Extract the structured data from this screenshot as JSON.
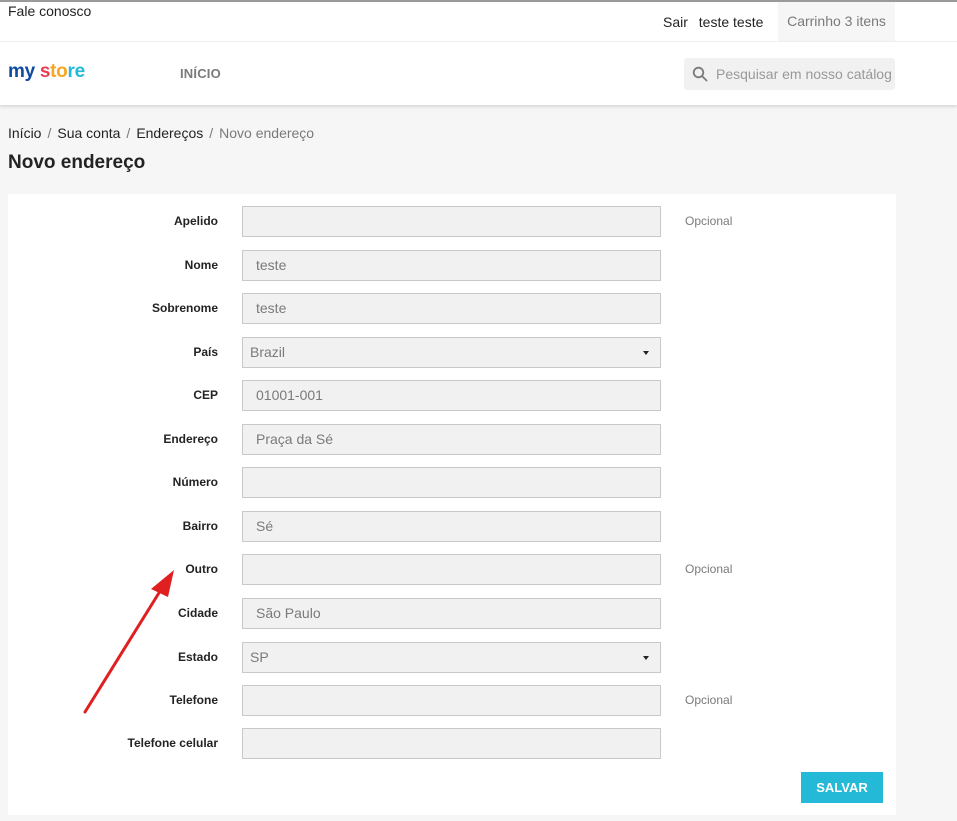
{
  "topbar": {
    "contact": "Fale conosco",
    "logout": "Sair",
    "user": "teste teste",
    "cart": "Carrinho 3 itens"
  },
  "header": {
    "logo_part1": "my",
    "logo_part2": "s",
    "logo_part3": "to",
    "logo_part4": "re",
    "menu_home": "INÍCIO",
    "search_placeholder": "Pesquisar em nosso catálogo",
    "search_icon": "search-icon"
  },
  "breadcrumb": [
    "Início",
    "Sua conta",
    "Endereços",
    "Novo endereço"
  ],
  "page_title": "Novo endereço",
  "form": {
    "fields": [
      {
        "label": "Apelido",
        "value": "",
        "optional": "Opcional"
      },
      {
        "label": "Nome",
        "value": "teste",
        "optional": ""
      },
      {
        "label": "Sobrenome",
        "value": "teste",
        "optional": ""
      },
      {
        "label": "País",
        "value": "Brazil",
        "optional": ""
      },
      {
        "label": "CEP",
        "value": "01001-001",
        "optional": ""
      },
      {
        "label": "Endereço",
        "value": "Praça da Sé",
        "optional": ""
      },
      {
        "label": "Número",
        "value": "",
        "optional": ""
      },
      {
        "label": "Bairro",
        "value": "Sé",
        "optional": ""
      },
      {
        "label": "Outro",
        "value": "",
        "optional": "Opcional"
      },
      {
        "label": "Cidade",
        "value": "São Paulo",
        "optional": ""
      },
      {
        "label": "Estado",
        "value": "SP",
        "optional": ""
      },
      {
        "label": "Telefone",
        "value": "",
        "optional": "Opcional"
      },
      {
        "label": "Telefone celular",
        "value": "",
        "optional": ""
      }
    ],
    "save_label": "SALVAR"
  },
  "colors": {
    "accent": "#24b9d7",
    "annotation_arrow": "#e02020"
  }
}
